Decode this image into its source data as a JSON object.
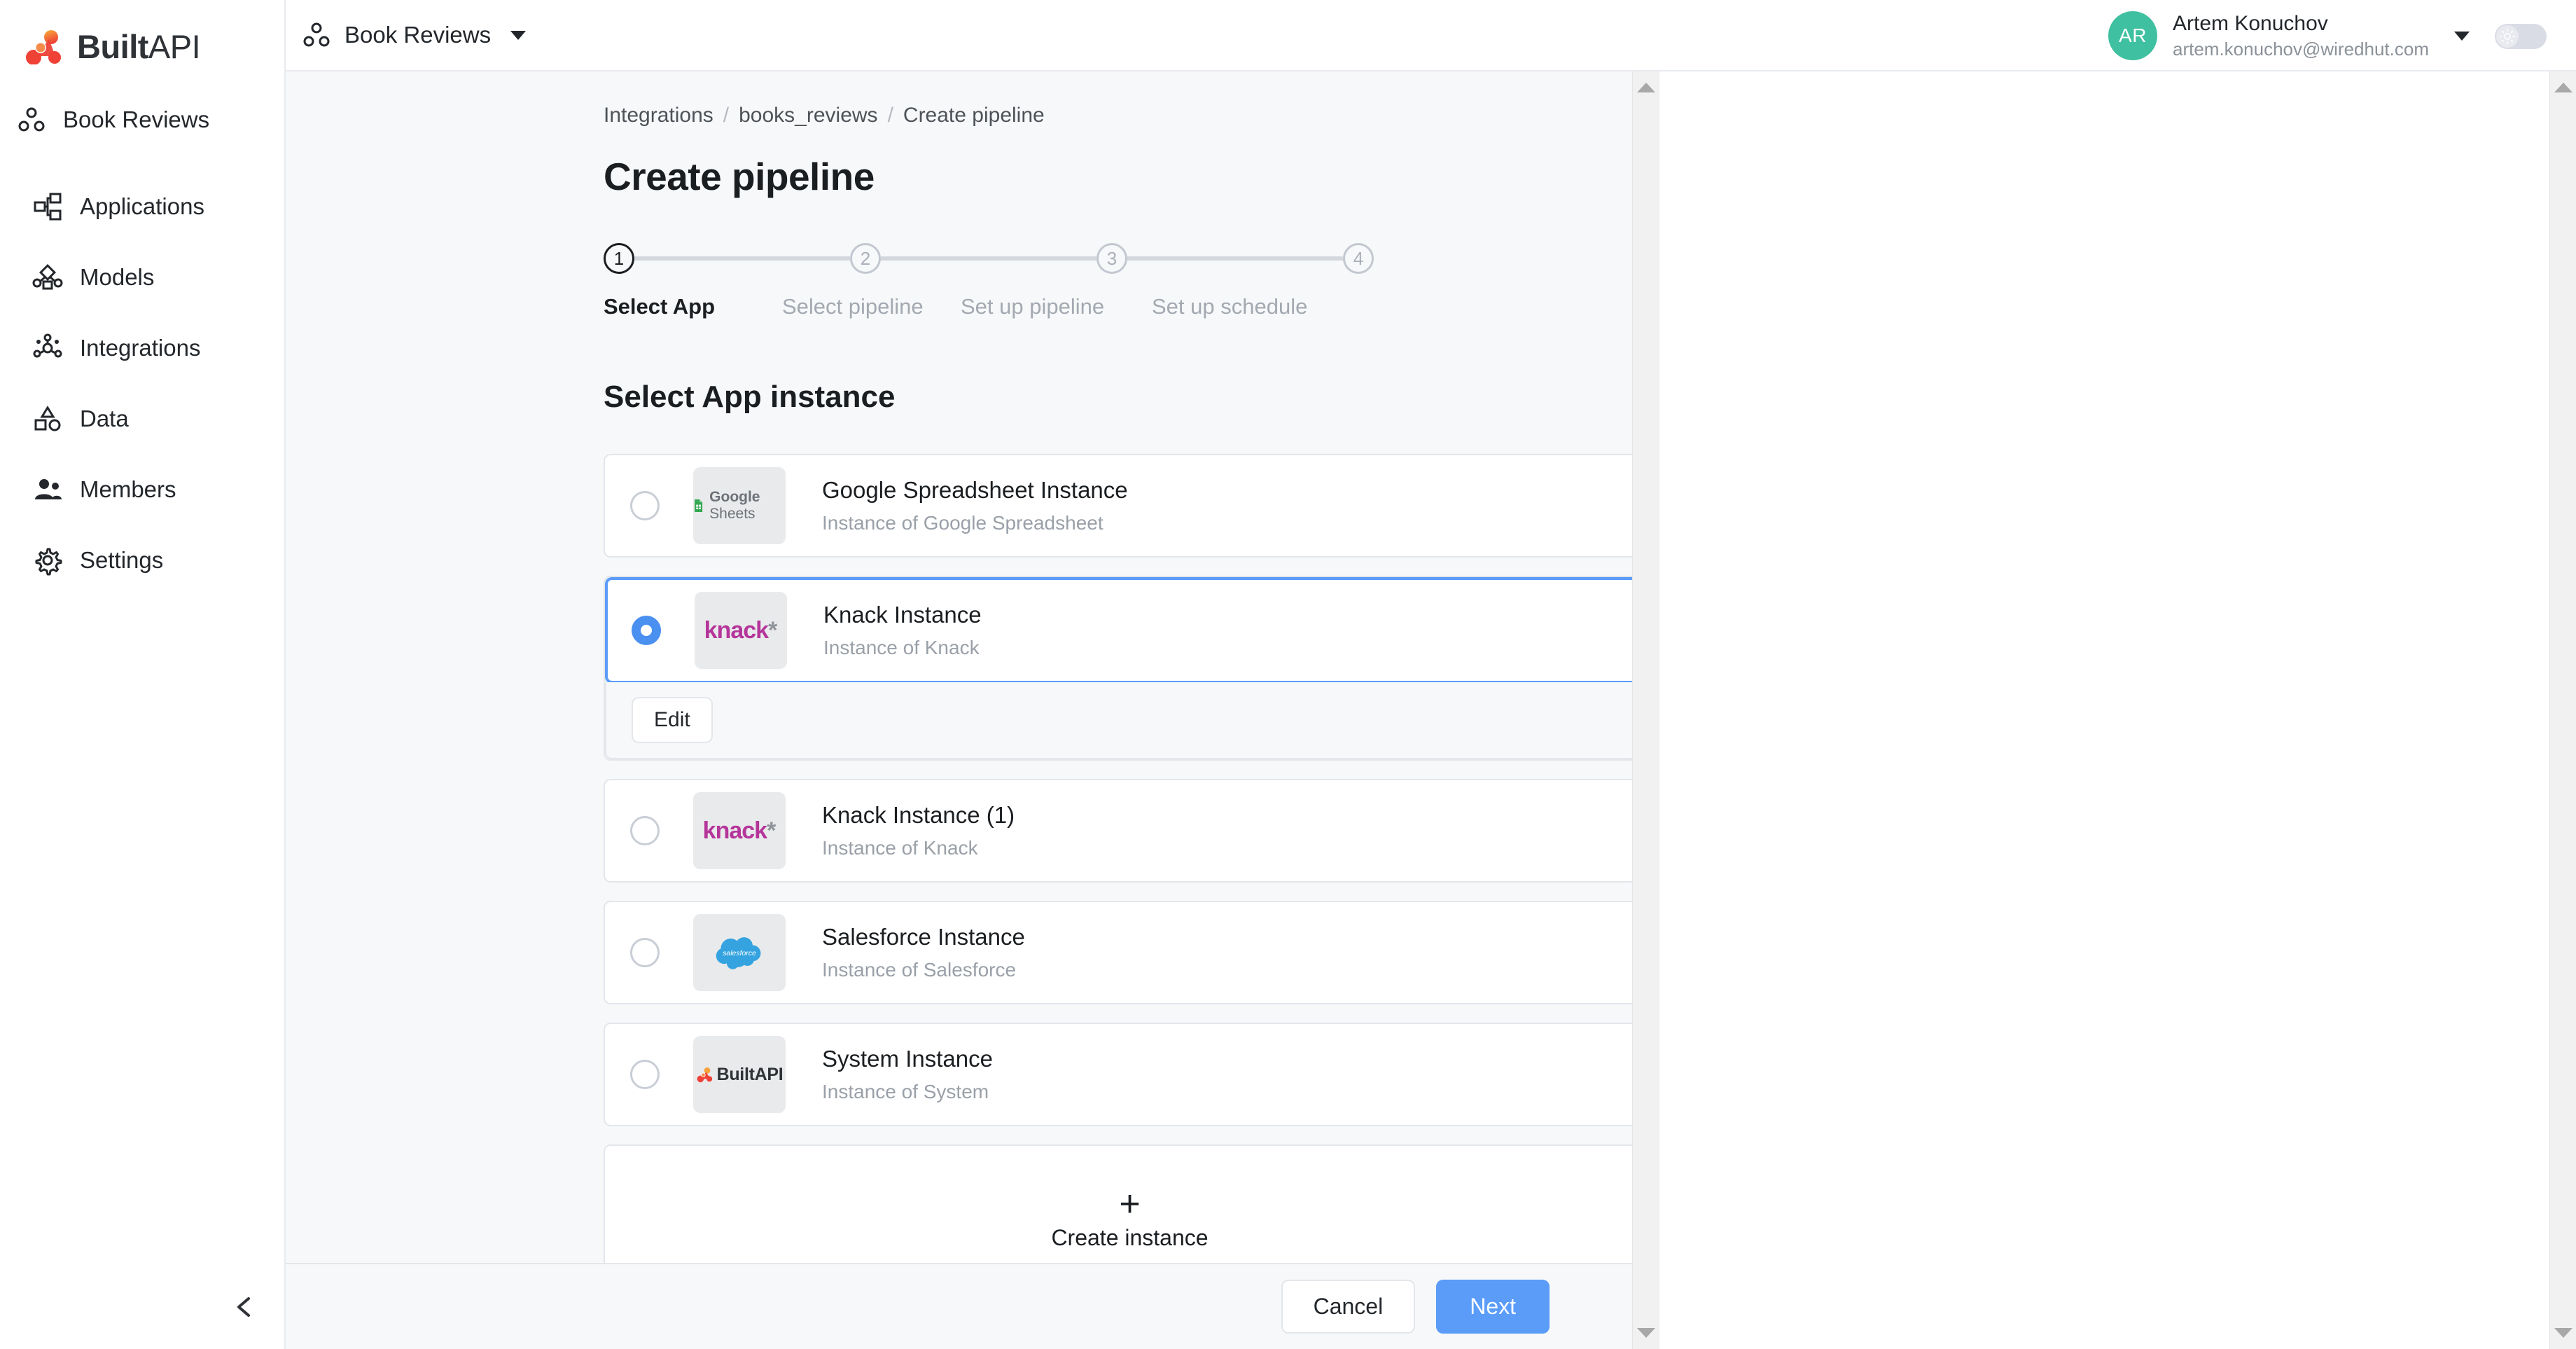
{
  "brand": {
    "name_bold": "Built",
    "name_light": "API",
    "logo_icon": "builtapi-logo-icon"
  },
  "sidebar": {
    "workspace": {
      "label": "Book Reviews",
      "icon": "workspace-dots-icon"
    },
    "items": [
      {
        "label": "Applications",
        "icon": "applications-icon"
      },
      {
        "label": "Models",
        "icon": "models-icon"
      },
      {
        "label": "Integrations",
        "icon": "integrations-icon"
      },
      {
        "label": "Data",
        "icon": "data-icon"
      },
      {
        "label": "Members",
        "icon": "members-icon"
      },
      {
        "label": "Settings",
        "icon": "gear-icon"
      }
    ],
    "collapse_icon": "chevron-left-icon"
  },
  "topbar": {
    "workspace_label": "Book Reviews",
    "workspace_icon": "workspace-dots-icon",
    "dropdown_icon": "caret-down-icon",
    "user": {
      "initials": "AR",
      "name": "Artem Konuchov",
      "email": "artem.konuchov@wiredhut.com",
      "avatar_color": "#3fc0a0"
    },
    "theme_toggle": {
      "icon": "sun-icon",
      "state": "off"
    }
  },
  "breadcrumb": {
    "items": [
      "Integrations",
      "books_reviews",
      "Create pipeline"
    ],
    "separator": "/"
  },
  "page": {
    "title": "Create pipeline",
    "section_title": "Select App instance"
  },
  "stepper": {
    "steps": [
      {
        "number": "1",
        "label": "Select App",
        "active": true
      },
      {
        "number": "2",
        "label": "Select pipeline",
        "active": false
      },
      {
        "number": "3",
        "label": "Set up pipeline",
        "active": false
      },
      {
        "number": "4",
        "label": "Set up schedule",
        "active": false
      }
    ]
  },
  "instances": [
    {
      "title": "Google Spreadsheet Instance",
      "subtitle": "Instance of Google Spreadsheet",
      "logo": "google-sheets-logo",
      "selected": false
    },
    {
      "title": "Knack Instance",
      "subtitle": "Instance of Knack",
      "logo": "knack-logo",
      "selected": true,
      "edit_label": "Edit"
    },
    {
      "title": "Knack Instance (1)",
      "subtitle": "Instance of Knack",
      "logo": "knack-logo",
      "selected": false
    },
    {
      "title": "Salesforce Instance",
      "subtitle": "Instance of Salesforce",
      "logo": "salesforce-logo",
      "selected": false
    },
    {
      "title": "System Instance",
      "subtitle": "Instance of System",
      "logo": "builtapi-logo",
      "selected": false
    }
  ],
  "create_instance": {
    "label": "Create instance",
    "icon": "plus-icon"
  },
  "footer": {
    "cancel_label": "Cancel",
    "next_label": "Next"
  },
  "colors": {
    "accent_blue": "#5a9cf8",
    "avatar_green": "#3fc0a0",
    "knack_magenta": "#b5359a",
    "sheets_green": "#34a853",
    "salesforce_blue": "#34a3e0",
    "page_bg": "#f7f8fa"
  },
  "logos": {
    "google_sheets": {
      "word1": "Google",
      "word2": "Sheets"
    },
    "knack": {
      "word": "knack",
      "star": "*"
    },
    "salesforce": {
      "word": "salesforce"
    },
    "builtapi": {
      "word1": "Built",
      "word2": "API"
    }
  }
}
